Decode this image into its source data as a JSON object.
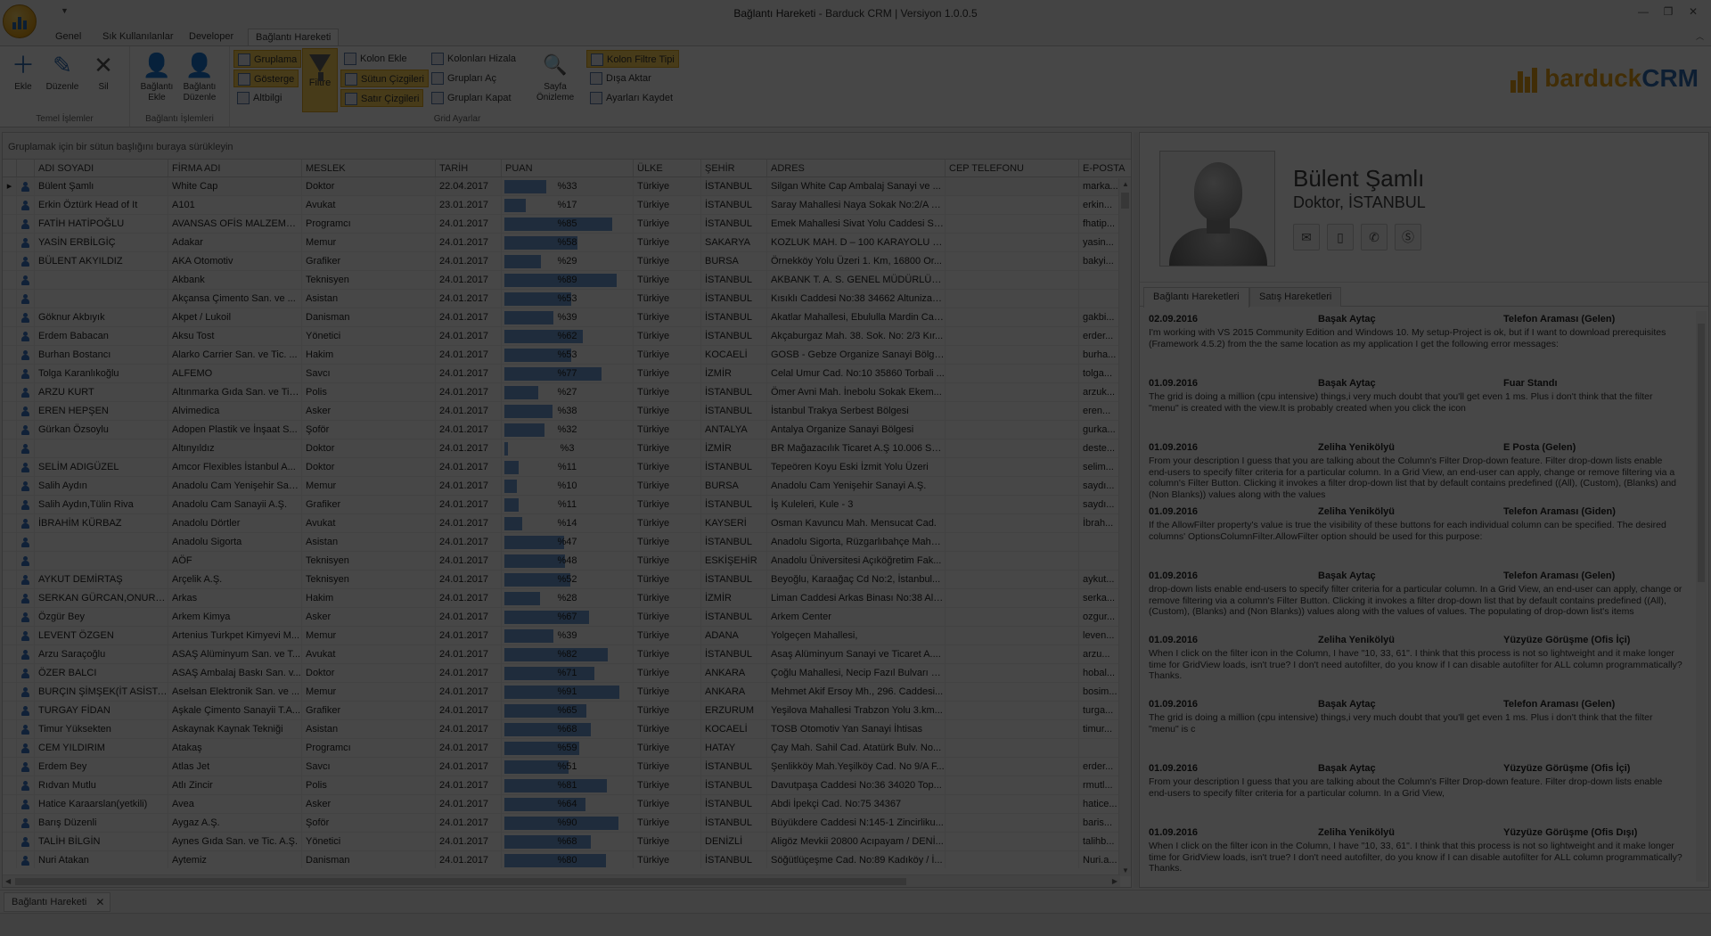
{
  "window": {
    "title": "Bağlantı Hareketi",
    "subtitle": " - Barduck CRM | Versiyon 1.0.0.5",
    "minimize_icon": "minimize-icon",
    "restore_icon": "restore-icon",
    "close_icon": "close-icon"
  },
  "ribbon": {
    "tabs": [
      {
        "label": "Genel"
      },
      {
        "label": "Sık Kullanılanlar"
      },
      {
        "label": "Developer"
      },
      {
        "label": "Bağlantı Hareketi"
      }
    ],
    "groups": {
      "basic": {
        "label": "Temel İşlemler",
        "add": "Ekle",
        "edit": "Düzenle",
        "delete": "Sil"
      },
      "contact": {
        "label": "Bağlantı İşlemleri",
        "add": "Bağlantı Ekle",
        "edit": "Bağlantı Düzenle"
      },
      "grid": {
        "label": "Grid Ayarlar",
        "grouping": "Gruplama",
        "show": "Gösterge",
        "footer": "Altbilgi",
        "filter": "Filtre",
        "add_column": "Kolon Ekle",
        "column_lines": "Sütun Çizgileri",
        "row_lines": "Satır Çizgileri",
        "align_columns": "Kolonları Hizala",
        "expand_groups": "Grupları Aç",
        "collapse_groups": "Grupları Kapat",
        "print_preview": "Sayfa Önizleme",
        "column_filter_type": "Kolon Filtre Tipi",
        "export": "Dışa Aktar",
        "save_settings": "Ayarları Kaydet"
      }
    },
    "logo": {
      "part1": "barduck",
      "part2": "CRM"
    }
  },
  "grid": {
    "group_panel_text": "Gruplamak için bir sütun başlığını buraya sürükleyin",
    "columns": [
      "ADI SOYADI",
      "FİRMA ADI",
      "MESLEK",
      "TARİH",
      "PUAN",
      "ÜLKE",
      "ŞEHİR",
      "ADRES",
      "CEP TELEFONU",
      "E-POSTA"
    ],
    "rows": [
      {
        "name": "Bülent Şamlı",
        "company": "White Cap",
        "job": "Doktor",
        "date": "22.04.2017",
        "score": 33,
        "country": "Türkiye",
        "city": "İSTANBUL",
        "address": "Silgan White Cap Ambalaj Sanayi ve ...",
        "phone": "",
        "email": "marka..."
      },
      {
        "name": "Erkin Öztürk Head of It",
        "company": "A101",
        "job": "Avukat",
        "date": "23.01.2017",
        "score": 17,
        "country": "Türkiye",
        "city": "İSTANBUL",
        "address": "Saray Mahallesi Naya Sokak No:2/A K...",
        "phone": "",
        "email": "erkin..."
      },
      {
        "name": "FATİH HATİPOĞLU",
        "company": "AVANSAS OFİS MALZEMEL...",
        "job": "Programcı",
        "date": "24.01.2017",
        "score": 85,
        "country": "Türkiye",
        "city": "İSTANBUL",
        "address": " Emek Mahallesi Sivat Yolu Caddesi Sa...",
        "phone": "",
        "email": "fhatip..."
      },
      {
        "name": "YASİN ERBİLGİÇ",
        "company": "Adakar",
        "job": "Memur",
        "date": "24.01.2017",
        "score": 58,
        "country": "Türkiye",
        "city": "SAKARYA",
        "address": "KOZLUK MAH. D – 100 KARAYOLU ÜZ...",
        "phone": "",
        "email": "yasin..."
      },
      {
        "name": "BÜLENT AKYILDIZ",
        "company": "AKA Otomotiv",
        "job": "Grafiker",
        "date": "24.01.2017",
        "score": 29,
        "country": "Türkiye",
        "city": "BURSA",
        "address": "Örnekköy Yolu Üzeri 1. Km, 16800 Or...",
        "phone": "",
        "email": "bakyi..."
      },
      {
        "name": "",
        "company": "Akbank",
        "job": "Teknisyen",
        "date": "24.01.2017",
        "score": 89,
        "country": "Türkiye",
        "city": "İSTANBUL",
        "address": "AKBANK T. A. S. GENEL MÜDÜRLÜĞÜ...",
        "phone": "",
        "email": ""
      },
      {
        "name": "",
        "company": "Akçansa Çimento San. ve ...",
        "job": "Asistan",
        "date": "24.01.2017",
        "score": 53,
        "country": "Türkiye",
        "city": "İSTANBUL",
        "address": "Kısıklı Caddesi No:38 34662 Altunizad...",
        "phone": "",
        "email": ""
      },
      {
        "name": "Göknur Akbıyık",
        "company": "Akpet / Lukoil",
        "job": "Danisman",
        "date": "24.01.2017",
        "score": 39,
        "country": "Türkiye",
        "city": "İSTANBUL",
        "address": "Akatlar Mahallesi, Ebululla Mardin Cad...",
        "phone": "",
        "email": "gakbi..."
      },
      {
        "name": "Erdem Babacan",
        "company": "Aksu Tost",
        "job": "Yönetici",
        "date": "24.01.2017",
        "score": 62,
        "country": "Türkiye",
        "city": "İSTANBUL",
        "address": "Akçaburgaz Mah. 38. Sok. No: 2/3 Kır...",
        "phone": "",
        "email": "erder..."
      },
      {
        "name": "Burhan Bostancı",
        "company": "Alarko Carrier San. ve Tic. ...",
        "job": "Hakim",
        "date": "24.01.2017",
        "score": 53,
        "country": "Türkiye",
        "city": "KOCAELİ",
        "address": " GOSB - Gebze Organize Sanayi Bölge...",
        "phone": "",
        "email": "burha..."
      },
      {
        "name": "Tolga Karanlıkoğlu",
        "company": "ALFEMO",
        "job": "Savcı",
        "date": "24.01.2017",
        "score": 77,
        "country": "Türkiye",
        "city": "İZMİR",
        "address": "Celal Umur Cad. No:10 35860 Torbali ...",
        "phone": "",
        "email": "tolga..."
      },
      {
        "name": "ARZU KURT",
        "company": "Altınmarka Gıda San. ve Tic...",
        "job": "Polis",
        "date": "24.01.2017",
        "score": 27,
        "country": "Türkiye",
        "city": "İSTANBUL",
        "address": "Ömer Avni Mah. İnebolu Sokak Ekem...",
        "phone": "",
        "email": "arzuk..."
      },
      {
        "name": "EREN HEPŞEN",
        "company": "Alvimedica",
        "job": "Asker",
        "date": "24.01.2017",
        "score": 38,
        "country": "Türkiye",
        "city": "İSTANBUL",
        "address": "İstanbul Trakya Serbest Bölgesi",
        "phone": "",
        "email": "eren..."
      },
      {
        "name": "Gürkan Özsoylu",
        "company": "Adopen Plastik ve İnşaat S...",
        "job": "Şoför",
        "date": "24.01.2017",
        "score": 32,
        "country": "Türkiye",
        "city": "ANTALYA",
        "address": "Antalya Organize Sanayi Bölgesi",
        "phone": "",
        "email": "gurka..."
      },
      {
        "name": "",
        "company": "Altınyıldız",
        "job": "Doktor",
        "date": "24.01.2017",
        "score": 3,
        "country": "Türkiye",
        "city": "İZMİR",
        "address": "BR Mağazacılık Ticaret A.Ş 10.006 SK...",
        "phone": "",
        "email": "deste..."
      },
      {
        "name": "SELİM ADIGÜZEL",
        "company": "Amcor Flexibles İstanbul A...",
        "job": "Doktor",
        "date": "24.01.2017",
        "score": 11,
        "country": "Türkiye",
        "city": "İSTANBUL",
        "address": "Tepeören Koyu Eski İzmit Yolu Üzeri",
        "phone": "",
        "email": "selim..."
      },
      {
        "name": "Salih Aydın",
        "company": "Anadolu Cam Yenişehir San...",
        "job": "Memur",
        "date": "24.01.2017",
        "score": 10,
        "country": "Türkiye",
        "city": "BURSA",
        "address": "Anadolu Cam Yenişehir Sanayi A.Ş.",
        "phone": "",
        "email": "saydı..."
      },
      {
        "name": "Salih Aydın,Tülin Riva",
        "company": "Anadolu Cam Sanayii A.Ş.",
        "job": "Grafiker",
        "date": "24.01.2017",
        "score": 11,
        "country": "Türkiye",
        "city": "İSTANBUL",
        "address": " İş Kuleleri, Kule - 3",
        "phone": "",
        "email": "saydı..."
      },
      {
        "name": "İBRAHİM KÜRBAZ",
        "company": "Anadolu Dörtler",
        "job": "Avukat",
        "date": "24.01.2017",
        "score": 14,
        "country": "Türkiye",
        "city": "KAYSERİ",
        "address": "Osman Kavuncu Mah.  Mensucat Cad.",
        "phone": "",
        "email": "İbrah..."
      },
      {
        "name": "",
        "company": "Anadolu Sigorta",
        "job": "Asistan",
        "date": "24.01.2017",
        "score": 47,
        "country": "Türkiye",
        "city": "İSTANBUL",
        "address": "Anadolu Sigorta, Rüzgarlıbahçe Maha...",
        "phone": "",
        "email": ""
      },
      {
        "name": "",
        "company": "AÖF",
        "job": "Teknisyen",
        "date": "24.01.2017",
        "score": 48,
        "country": "Türkiye",
        "city": "ESKİŞEHİR",
        "address": "Anadolu Üniversitesi Açıköğretim Fak...",
        "phone": "",
        "email": ""
      },
      {
        "name": "AYKUT DEMİRTAŞ",
        "company": "Arçelik A.Ş.",
        "job": "Teknisyen",
        "date": "24.01.2017",
        "score": 52,
        "country": "Türkiye",
        "city": "İSTANBUL",
        "address": "Beyoğlu, Karaağaç Cd No:2, İstanbul...",
        "phone": "",
        "email": "aykut..."
      },
      {
        "name": "SERKAN GÜRCAN,ONUR K...",
        "company": "Arkas",
        "job": "Hakim",
        "date": "24.01.2017",
        "score": 28,
        "country": "Türkiye",
        "city": "İZMİR",
        "address": "Liman Caddesi Arkas Binası No:38 Als...",
        "phone": "",
        "email": "serka..."
      },
      {
        "name": "Özgür Bey",
        "company": "Arkem Kimya",
        "job": "Asker",
        "date": "24.01.2017",
        "score": 67,
        "country": "Türkiye",
        "city": "İSTANBUL",
        "address": "Arkem Center",
        "phone": "",
        "email": "ozgur..."
      },
      {
        "name": "LEVENT ÖZGEN",
        "company": "Artenius Turkpet Kimyevi M...",
        "job": "Memur",
        "date": "24.01.2017",
        "score": 39,
        "country": "Türkiye",
        "city": "ADANA",
        "address": "Yolgeçen Mahallesi,",
        "phone": "",
        "email": "leven..."
      },
      {
        "name": "Arzu Saraçoğlu",
        "company": "ASAŞ Alüminyum San. ve T...",
        "job": "Avukat",
        "date": "24.01.2017",
        "score": 82,
        "country": "Türkiye",
        "city": "İSTANBUL",
        "address": "Asaş Alüminyum Sanayi ve Ticaret A....",
        "phone": "",
        "email": "arzu..."
      },
      {
        "name": "ÖZER BALCI",
        "company": "ASAŞ Ambalaj Baskı San. v...",
        "job": "Doktor",
        "date": "24.01.2017",
        "score": 71,
        "country": "Türkiye",
        "city": "ANKARA",
        "address": "Çoğlu Mahallesi, Necip Fazıl Bulvarı N...",
        "phone": "",
        "email": "hobal..."
      },
      {
        "name": "BURÇIN ŞİMŞEK(İT ASİSTA...",
        "company": "Aselsan Elektronik San. ve ...",
        "job": "Memur",
        "date": "24.01.2017",
        "score": 91,
        "country": "Türkiye",
        "city": "ANKARA",
        "address": "Mehmet Akif Ersoy Mh., 296. Caddesi...",
        "phone": "",
        "email": "bosim..."
      },
      {
        "name": "TURGAY FİDAN",
        "company": "Aşkale Çimento Sanayii T.A...",
        "job": "Grafiker",
        "date": "24.01.2017",
        "score": 65,
        "country": "Türkiye",
        "city": "ERZURUM",
        "address": "Yeşilova Mahallesi Trabzon Yolu 3.km...",
        "phone": "",
        "email": "turga..."
      },
      {
        "name": "Timur Yüksekten",
        "company": "Askaynak Kaynak Tekniği",
        "job": "Asistan",
        "date": "24.01.2017",
        "score": 68,
        "country": "Türkiye",
        "city": "KOCAELİ",
        "address": "TOSB Otomotiv Yan Sanayi İhtisas",
        "phone": "",
        "email": "timur..."
      },
      {
        "name": "CEM YILDIRIM",
        "company": "Atakaş",
        "job": "Programcı",
        "date": "24.01.2017",
        "score": 59,
        "country": "Türkiye",
        "city": "HATAY",
        "address": "Çay Mah. Sahil Cad. Atatürk Bulv. No...",
        "phone": "",
        "email": ""
      },
      {
        "name": "Erdem Bey",
        "company": "Atlas Jet",
        "job": "Savcı",
        "date": "24.01.2017",
        "score": 51,
        "country": "Türkiye",
        "city": "İSTANBUL",
        "address": "Şenlikköy Mah.Yeşilköy Cad. No 9/A F...",
        "phone": "",
        "email": "erder..."
      },
      {
        "name": "Rıdvan Mutlu",
        "company": "Atlı Zincir",
        "job": "Polis",
        "date": "24.01.2017",
        "score": 81,
        "country": "Türkiye",
        "city": "İSTANBUL",
        "address": "Davutpaşa Caddesi No:36 34020 Top...",
        "phone": "",
        "email": "rmutl..."
      },
      {
        "name": "Hatice Karaarslan(yetkili)",
        "company": "Avea",
        "job": "Asker",
        "date": "24.01.2017",
        "score": 64,
        "country": "Türkiye",
        "city": "İSTANBUL",
        "address": "Abdi İpekçi Cad. No:75 34367",
        "phone": "",
        "email": "hatice..."
      },
      {
        "name": "Barış Düzenli",
        "company": "Aygaz A.Ş.",
        "job": "Şoför",
        "date": "24.01.2017",
        "score": 90,
        "country": "Türkiye",
        "city": "İSTANBUL",
        "address": "Büyükdere Caddesi N:145-1 Zincirliku...",
        "phone": "",
        "email": "baris..."
      },
      {
        "name": "TALİH BİLGİN",
        "company": "Aynes Gıda San. ve Tic. A.Ş.",
        "job": "Yönetici",
        "date": "24.01.2017",
        "score": 68,
        "country": "Türkiye",
        "city": "DENİZLİ",
        "address": "Aligöz Mevkii 20800 Acıpayam / DENİ...",
        "phone": "",
        "email": "talihb..."
      },
      {
        "name": "Nuri Atakan",
        "company": "Aytemiz",
        "job": "Danisman",
        "date": "24.01.2017",
        "score": 80,
        "country": "Türkiye",
        "city": "İSTANBUL",
        "address": "Söğütlüçeşme Cad. No:89 Kadıköy / İ...",
        "phone": "",
        "email": "Nuri.a..."
      }
    ]
  },
  "detail": {
    "name": "Bülent Şamlı",
    "subtitle": "Doktor, İSTANBUL",
    "contact_buttons": [
      {
        "icon": "mail-icon"
      },
      {
        "icon": "mobile-icon"
      },
      {
        "icon": "phone-icon"
      },
      {
        "icon": "skype-icon"
      }
    ],
    "tabs": [
      {
        "label": "Bağlantı Hareketleri"
      },
      {
        "label": "Satış Hareketleri"
      }
    ],
    "activities": [
      {
        "date": "02.09.2016",
        "person": "Başak Aytaç",
        "type": "Telefon Araması (Gelen)",
        "text": "I'm working with VS 2015 Community Edition and Windows 10. My setup-Project is ok, but if I want to download prerequisites (Framework 4.5.2) from the the same location as my application I get the following error messages:"
      },
      {
        "date": "01.09.2016",
        "person": "Başak Aytaç",
        "type": "Fuar Standı",
        "text": "The grid is doing a million (cpu intensive) things,i very much doubt that you'll get even 1 ms.\nPlus i don't think that the filter \"menu\" is created with the view.It is probably created when you click the icon"
      },
      {
        "date": "01.09.2016",
        "person": "Zeliha Yenikölyü",
        "type": "E Posta (Gelen)",
        "text": "From your description I guess that you are talking about the Column's Filter Drop-down feature. Filter drop-down lists enable end-users to specify filter criteria for a particular column.\nIn a Grid View, an end-user can apply, change or remove filtering via a column's Filter Button. Clicking it invokes a filter drop-down list that by default contains predefined ((All), (Custom), (Blanks) and (Non Blanks)) values along with the values"
      },
      {
        "date": "01.09.2016",
        "person": "Zeliha Yenikölyü",
        "type": "Telefon Araması (Giden)",
        "text": "If the AllowFilter property's value is true the visibility of these buttons for each individual column can be specified. The desired columns' OptionsColumnFilter.AllowFilter option should be used for this purpose:"
      },
      {
        "date": "01.09.2016",
        "person": "Başak Aytaç",
        "type": "Telefon Araması (Gelen)",
        "text": "drop-down lists enable end-users to specify filter criteria for a particular column.\nIn a Grid View, an end-user can apply, change or remove filtering via a column's Filter Button. Clicking it invokes a filter drop-down list that by default contains predefined ((All), (Custom), (Blanks) and (Non Blanks)) values along with the values of values. The populating of drop-down list's items"
      },
      {
        "date": "01.09.2016",
        "person": "Zeliha Yenikölyü",
        "type": "Yüzyüze Görüşme (Ofis İçi)",
        "text": "When I click on the filter icon in the Column, I have \"10, 33, 61\". I think that this process is not so lightweight and it make longer time for GridView loads, isn't true? I don't need autofilter, do you know if I can disable autofilter for ALL column programmatically? Thanks."
      },
      {
        "date": "01.09.2016",
        "person": "Başak Aytaç",
        "type": "Telefon Araması (Gelen)",
        "text": "The grid is doing a million (cpu intensive) things,i very much doubt that you'll get even 1 ms.\nPlus i don't think that the filter \"menu\" is c"
      },
      {
        "date": "01.09.2016",
        "person": "Başak Aytaç",
        "type": "Yüzyüze Görüşme (Ofis İçi)",
        "text": "From your description I guess that you are talking about the Column's Filter Drop-down feature. Filter drop-down lists enable end-users to specify filter criteria for a particular column.\nIn a Grid View,"
      },
      {
        "date": "01.09.2016",
        "person": "Zeliha Yenikölyü",
        "type": "Yüzyüze Görüşme (Ofis Dışı)",
        "text": "When I click on the filter icon in the Column, I have \"10, 33, 61\". I think that this process is not so lightweight and it make longer time for GridView loads, isn't true? I don't need autofilter, do you know if I can disable autofilter for ALL column programmatically? Thanks."
      }
    ]
  },
  "doc_tab": {
    "label": "Bağlantı Hareketi"
  },
  "colors": {
    "accent": "#2f6eb5",
    "brand_orange": "#e8a317",
    "highlight": "#ffd55a",
    "progress": "#6f9fd8"
  }
}
